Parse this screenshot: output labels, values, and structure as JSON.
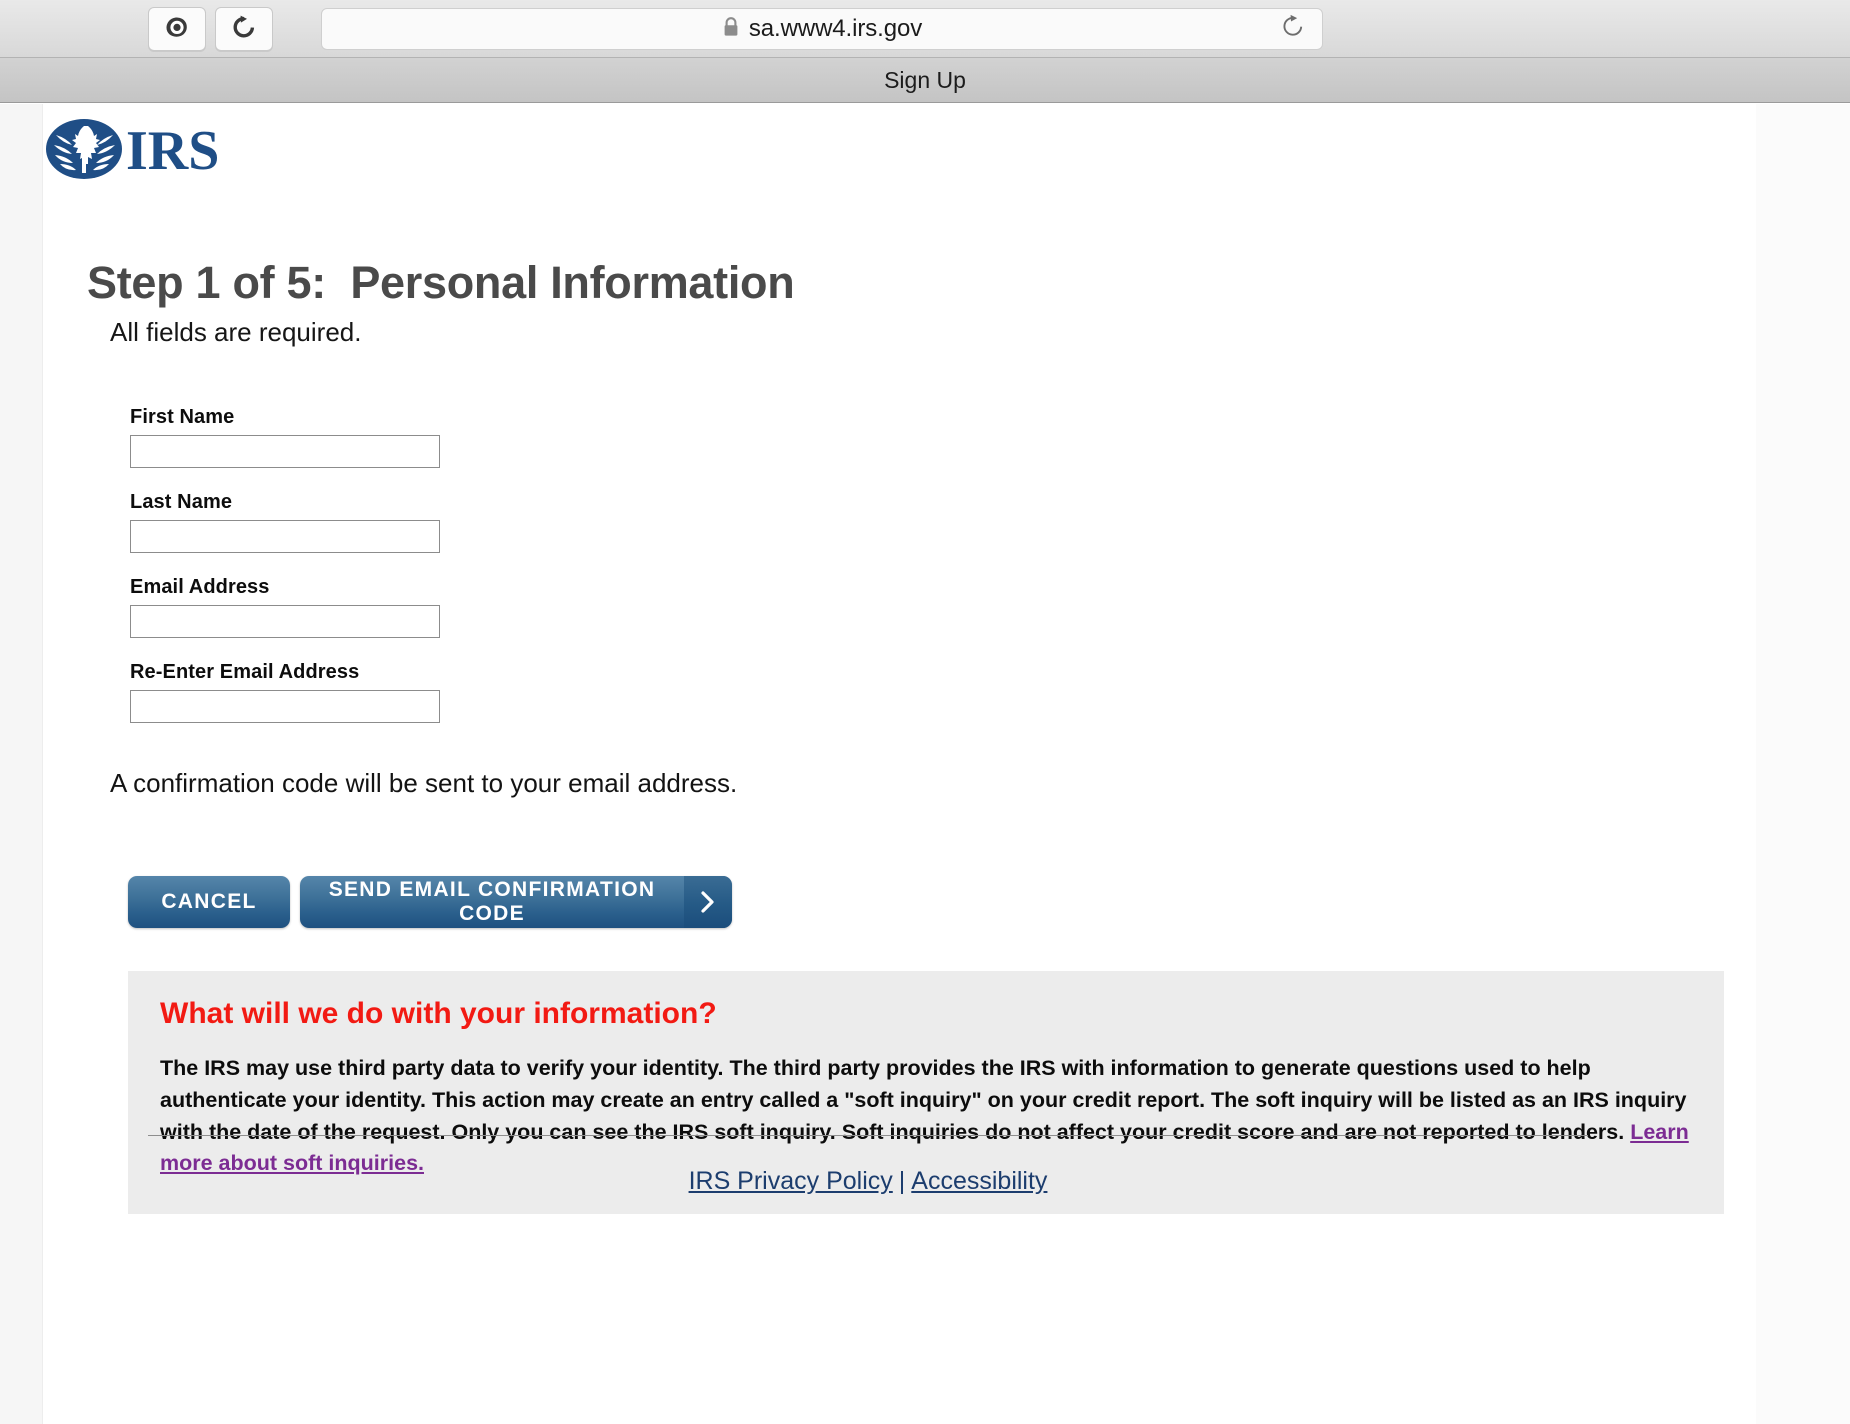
{
  "browser": {
    "reader_icon": "reader-target-icon",
    "reload_icon": "reload-icon",
    "url_text": "sa.www4.irs.gov",
    "lock_icon": "lock-icon",
    "url_reload_icon": "reload-icon"
  },
  "title_bar": {
    "title": "Sign Up"
  },
  "site": {
    "logo_alt": "IRS"
  },
  "main": {
    "heading": "Step 1 of 5:  Personal Information",
    "subheading": "All fields are required.",
    "confirmation_note": "A confirmation code will be sent to your email address.",
    "fields": [
      {
        "label": "First Name",
        "value": "",
        "placeholder": ""
      },
      {
        "label": "Last Name",
        "value": "",
        "placeholder": ""
      },
      {
        "label": "Email Address",
        "value": "",
        "placeholder": ""
      },
      {
        "label": "Re-Enter Email Address",
        "value": "",
        "placeholder": ""
      }
    ],
    "buttons": {
      "cancel": "CANCEL",
      "send": "SEND EMAIL CONFIRMATION CODE",
      "send_chevron_icon": "chevron-right-icon"
    }
  },
  "info_box": {
    "title": "What will we do with your information?",
    "body": "The IRS may use third party data to verify your identity. The third party provides the IRS with information to generate questions used to help authenticate your identity. This action may create an entry called a \"soft inquiry\" on your credit report. The soft inquiry will be listed as an IRS inquiry with the date of the request. Only you can see the IRS soft inquiry. Soft inquiries do not affect your credit score and are not reported to lenders. ",
    "link_text": "Learn more about soft inquiries."
  },
  "footer": {
    "privacy_link": "IRS Privacy Policy",
    "separator": "|",
    "accessibility_link": "Accessibility"
  },
  "colors": {
    "heading_gray": "#4a4a4a",
    "button_blue": "#2a5f8c",
    "info_title_red": "#f21a13",
    "info_link_purple": "#7c2c93",
    "footer_link_blue": "#1c3d6e",
    "irs_logo_blue": "#1f4e86"
  }
}
